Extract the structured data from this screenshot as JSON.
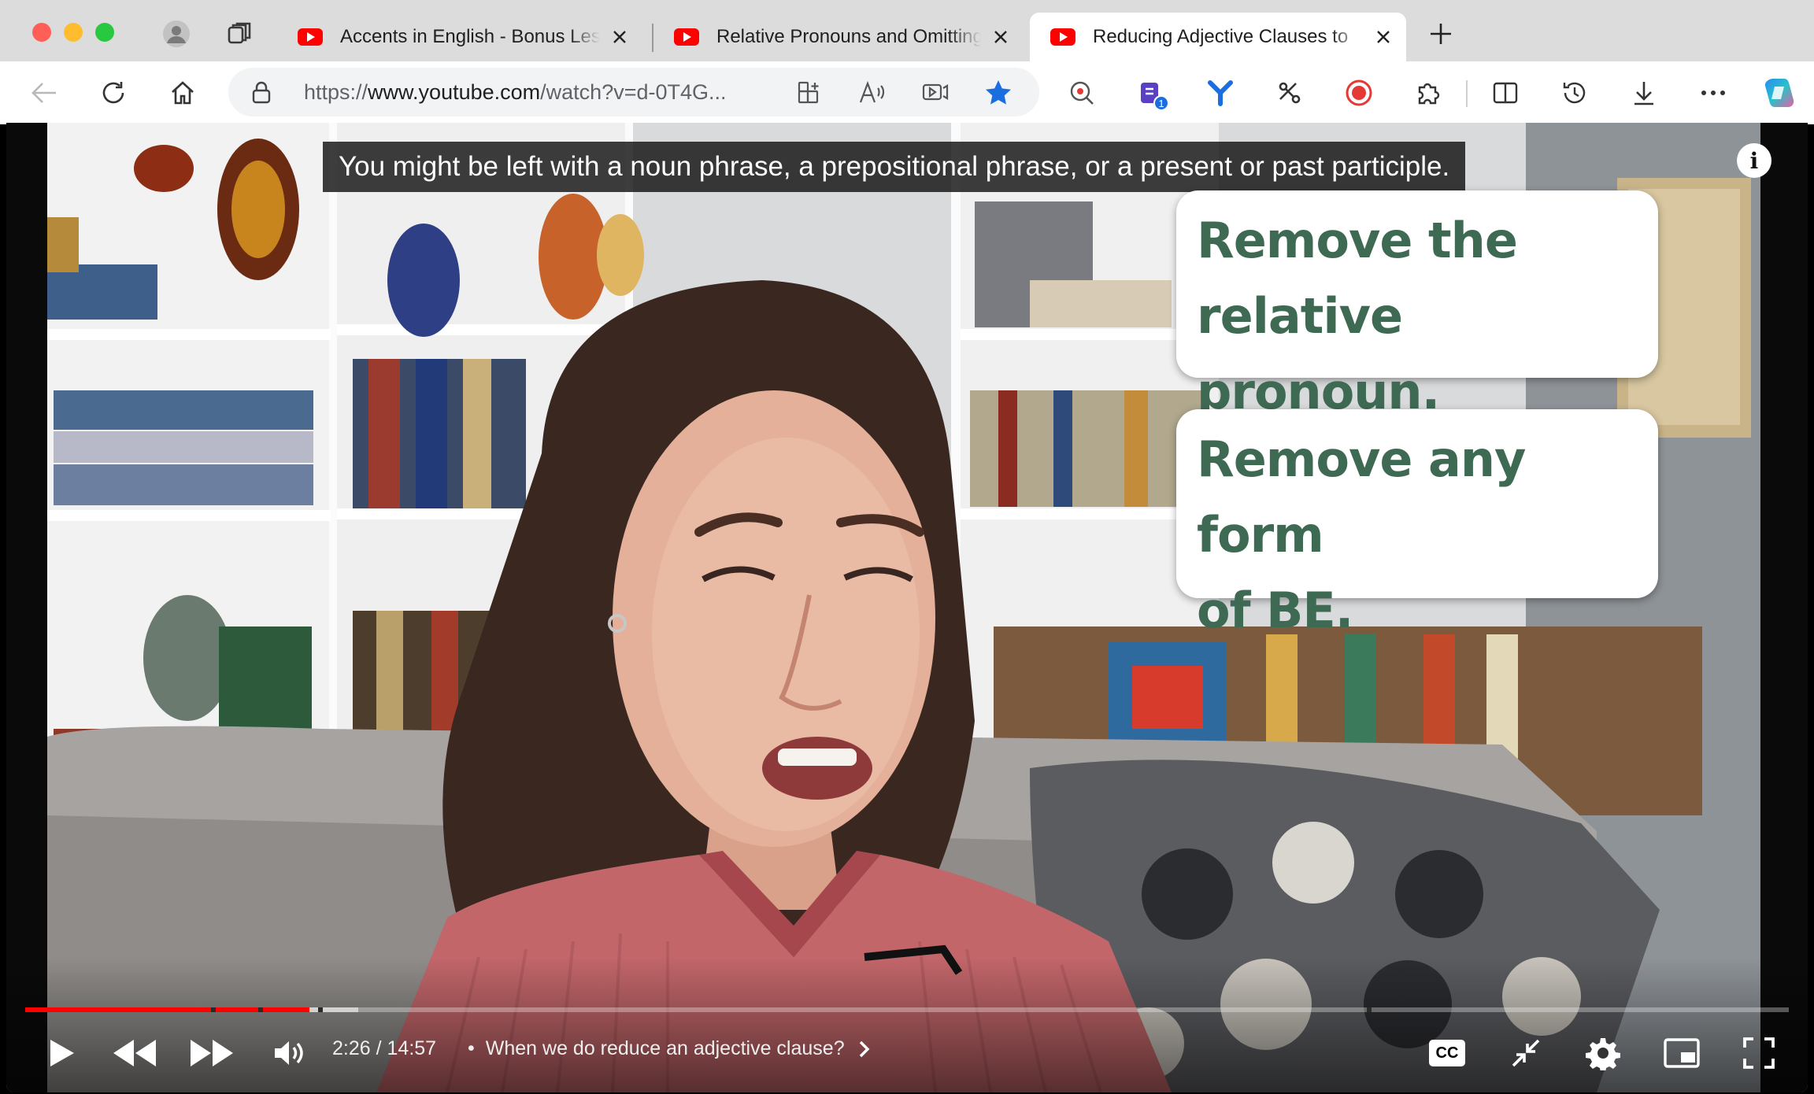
{
  "browser": {
    "tabs": [
      {
        "title": "Accents in English - Bonus Lesson"
      },
      {
        "title": "Relative Pronouns and Omitting"
      },
      {
        "title": "Reducing Adjective Clauses to"
      }
    ],
    "url": {
      "prefix": "https://",
      "domain": "www.youtube.com",
      "path": "/watch?v=d-0T4G..."
    },
    "extension_badge": "1",
    "accent_color": "#1a6ee0"
  },
  "video": {
    "caption": "You might be left with a noun phrase, a prepositional phrase, or a present or past participle.",
    "callouts": [
      {
        "line1": "Remove the",
        "line2": "relative pronoun."
      },
      {
        "line1": "Remove any form",
        "line2": "of BE."
      }
    ],
    "info_label": "i",
    "progress": {
      "played_fraction": 0.161,
      "buffered_fraction": 0.189,
      "played_color": "#ff0000"
    },
    "time_current": "2:26",
    "time_separator": " / ",
    "time_total": "14:57",
    "chapter_separator": "•",
    "chapter_title": "When we do reduce an adjective clause?",
    "cc_label": "CC"
  }
}
